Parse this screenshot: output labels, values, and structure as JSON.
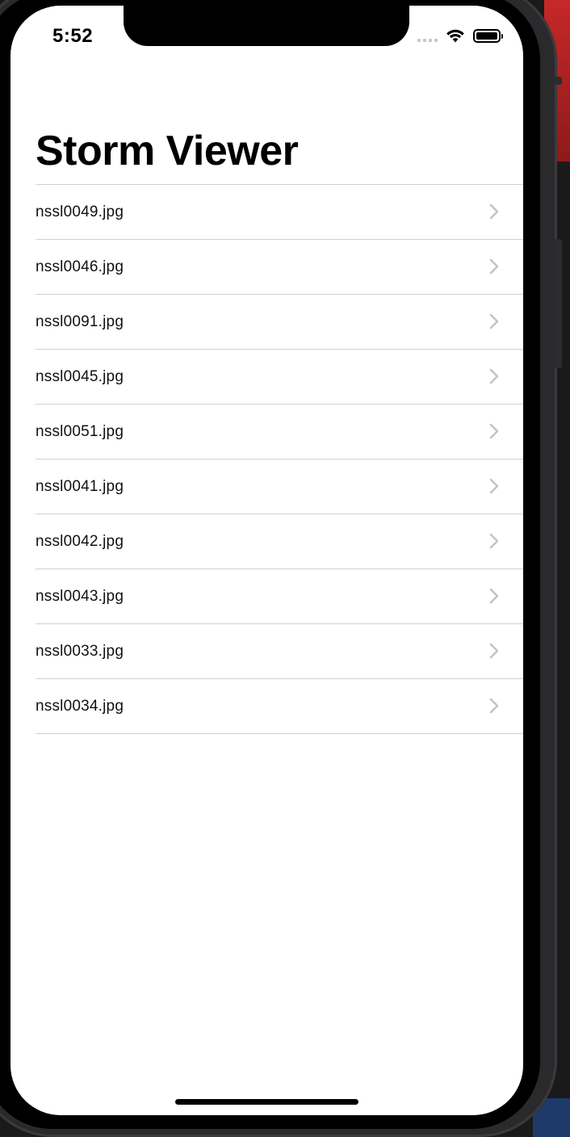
{
  "status_bar": {
    "time": "5:52",
    "icons": [
      "cellular-signal-icon",
      "wifi-icon",
      "battery-icon"
    ]
  },
  "navigation": {
    "title": "Storm Viewer"
  },
  "table": {
    "rows": [
      {
        "label": "nssl0049.jpg"
      },
      {
        "label": "nssl0046.jpg"
      },
      {
        "label": "nssl0091.jpg"
      },
      {
        "label": "nssl0045.jpg"
      },
      {
        "label": "nssl0051.jpg"
      },
      {
        "label": "nssl0041.jpg"
      },
      {
        "label": "nssl0042.jpg"
      },
      {
        "label": "nssl0043.jpg"
      },
      {
        "label": "nssl0033.jpg"
      },
      {
        "label": "nssl0034.jpg"
      }
    ],
    "accessory_icon": "chevron-right-icon"
  },
  "colors": {
    "screen_background": "#ffffff",
    "separator": "#d1d1d6",
    "chevron": "#c4c4c7",
    "text": "#111111"
  }
}
